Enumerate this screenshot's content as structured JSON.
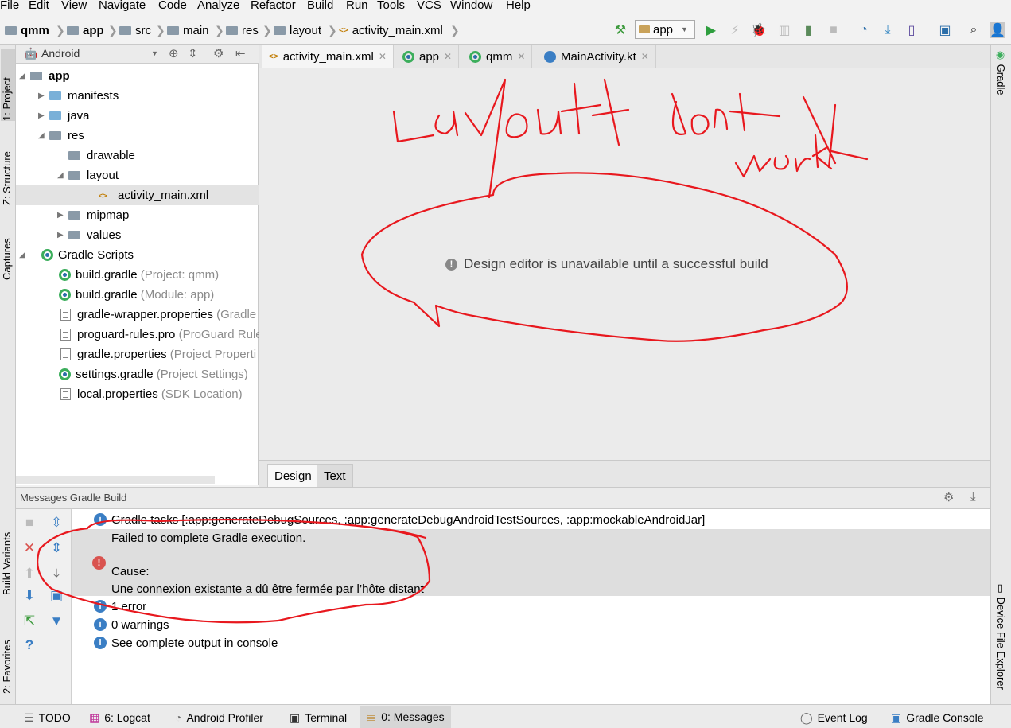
{
  "menu": [
    "File",
    "Edit",
    "View",
    "Navigate",
    "Code",
    "Analyze",
    "Refactor",
    "Build",
    "Run",
    "Tools",
    "VCS",
    "Window",
    "Help"
  ],
  "breadcrumb": [
    "qmm",
    "app",
    "src",
    "main",
    "res",
    "layout",
    "activity_main.xml"
  ],
  "run_config": "app",
  "project_view": "Android",
  "left_tabs": {
    "project": "1: Project",
    "structure": "Z: Structure",
    "captures": "Captures",
    "build_variants": "Build Variants",
    "favorites": "2: Favorites"
  },
  "right_tabs": {
    "gradle": "Gradle",
    "device_file_explorer": "Device File Explorer"
  },
  "tree": {
    "app": "app",
    "manifests": "manifests",
    "java": "java",
    "res": "res",
    "drawable": "drawable",
    "layout": "layout",
    "activity_main": "activity_main.xml",
    "mipmap": "mipmap",
    "values": "values",
    "gradle_scripts": "Gradle Scripts",
    "build_gradle_project": {
      "name": "build.gradle",
      "hint": "(Project: qmm)"
    },
    "build_gradle_module": {
      "name": "build.gradle",
      "hint": "(Module: app)"
    },
    "gradle_wrapper": {
      "name": "gradle-wrapper.properties",
      "hint": "(Gradle"
    },
    "proguard": {
      "name": "proguard-rules.pro",
      "hint": "(ProGuard Rule"
    },
    "gradle_properties": {
      "name": "gradle.properties",
      "hint": "(Project Properti"
    },
    "settings_gradle": {
      "name": "settings.gradle",
      "hint": "(Project Settings)"
    },
    "local_properties": {
      "name": "local.properties",
      "hint": "(SDK Location)"
    }
  },
  "editor_tabs": [
    "activity_main.xml",
    "app",
    "qmm",
    "MainActivity.kt"
  ],
  "editor_message": "Design editor is unavailable until a successful build",
  "design_tabs": [
    "Design",
    "Text"
  ],
  "messages_title": "Messages Gradle Build",
  "messages": {
    "tasks": "Gradle tasks [:app:generateDebugSources, :app:generateDebugAndroidTestSources, :app:mockableAndroidJar]",
    "failed": "Failed to complete Gradle execution.",
    "cause": "Cause:",
    "cause_detail": "Une connexion existante a dû être fermée par l’hôte distant",
    "errors": "1 error",
    "warnings": "0 warnings",
    "output": "See complete output in console"
  },
  "status_tabs": {
    "todo": "TODO",
    "logcat": "6: Logcat",
    "profiler": "Android Profiler",
    "terminal": "Terminal",
    "messages": "0: Messages",
    "event_log": "Event Log",
    "gradle_console": "Gradle Console"
  },
  "colors": {
    "annotation": "#e8181e",
    "gradle_green": "#3cae5c",
    "info_blue": "#3a7ec4",
    "error_red": "#d9534f"
  }
}
